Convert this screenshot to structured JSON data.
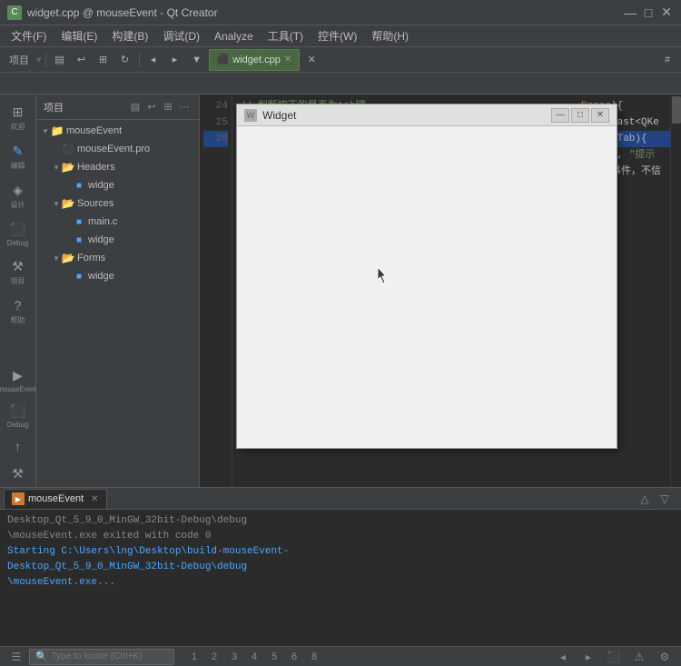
{
  "titleBar": {
    "icon": "C",
    "title": "widget.cpp @ mouseEvent - Qt Creator",
    "minimize": "—",
    "maximize": "□",
    "close": "✕"
  },
  "menuBar": {
    "items": [
      "文件(F)",
      "编辑(E)",
      "构建(B)",
      "调试(D)",
      "Analyze",
      "工具(T)",
      "控件(W)",
      "帮助(H)"
    ]
  },
  "toolbar": {
    "project_label": "项目",
    "tab_label": "widget.cpp",
    "hash": "#"
  },
  "fileTree": {
    "header": "项目",
    "project": "mouseEvent",
    "proFile": "mouseEvent.pro",
    "headersFolder": "Headers",
    "headerFile": "widge",
    "sourcesFolder": "Sources",
    "sourceFiles": [
      "main.c",
      "widge"
    ],
    "formsFolder": "Forms",
    "formFile": "widge"
  },
  "codeLines": [
    {
      "num": "24",
      "text": "    // 判断按下的是否为tab键"
    },
    {
      "num": "25",
      "text": "    if(keyEvent->key() == Qt::Key_Tab){"
    },
    {
      "num": "26",
      "text": "        QMessageBox::question(this, \"提示"
    }
  ],
  "codeHidden": [
    {
      "text": "Press){"
    },
    {
      "text": "atic_cast<QKe"
    },
    {
      "text": "::Key_Tab){"
    },
    {
      "text": "n(this, \"提示"
    },
    {
      "text": "理这个事件，不信"
    }
  ],
  "widgetPopup": {
    "title": "Widget",
    "iconChar": "W",
    "minimize": "—",
    "maximize": "□",
    "close": "✕"
  },
  "bottomPanel": {
    "tabLabel": "mouseEvent",
    "tabIcon": "▶",
    "lines": [
      {
        "text": "Desktop_Qt_5_9_0_MinGW_32bit-Debug\\debug",
        "type": "dim"
      },
      {
        "text": "\\mouseEvent.exe exited with code 0",
        "type": "dim"
      },
      {
        "text": "",
        "type": "dim"
      },
      {
        "text": "Starting C:\\Users\\lng\\Desktop\\build-mouseEvent-",
        "type": "blue"
      },
      {
        "text": "Desktop_Qt_5_9_0_MinGW_32bit-Debug\\debug",
        "type": "blue"
      },
      {
        "text": "\\mouseEvent.exe...",
        "type": "blue"
      }
    ]
  },
  "statusBar": {
    "searchPlaceholder": "Type to locate (Ctrl+K)",
    "pages": [
      "1",
      "2",
      "3",
      "4",
      "5",
      "6",
      "8"
    ],
    "navArrows": [
      "◂",
      "▸"
    ],
    "rightIcons": [
      "⚙",
      "◑",
      "□"
    ]
  },
  "sideIcons": [
    {
      "icon": "⊞",
      "label": "欢迎"
    },
    {
      "icon": "✎",
      "label": "编辑",
      "active": true
    },
    {
      "icon": "◈",
      "label": "设计"
    },
    {
      "icon": "⬛",
      "label": "Debug"
    },
    {
      "icon": "⚒",
      "label": "项目"
    },
    {
      "icon": "?",
      "label": "帮助"
    }
  ],
  "sideBottomIcons": [
    {
      "icon": "▶",
      "label": "mouseEvent"
    },
    {
      "icon": "⬛",
      "label": "Debug"
    },
    {
      "icon": "↑",
      "label": ""
    },
    {
      "icon": "⚒",
      "label": ""
    }
  ]
}
